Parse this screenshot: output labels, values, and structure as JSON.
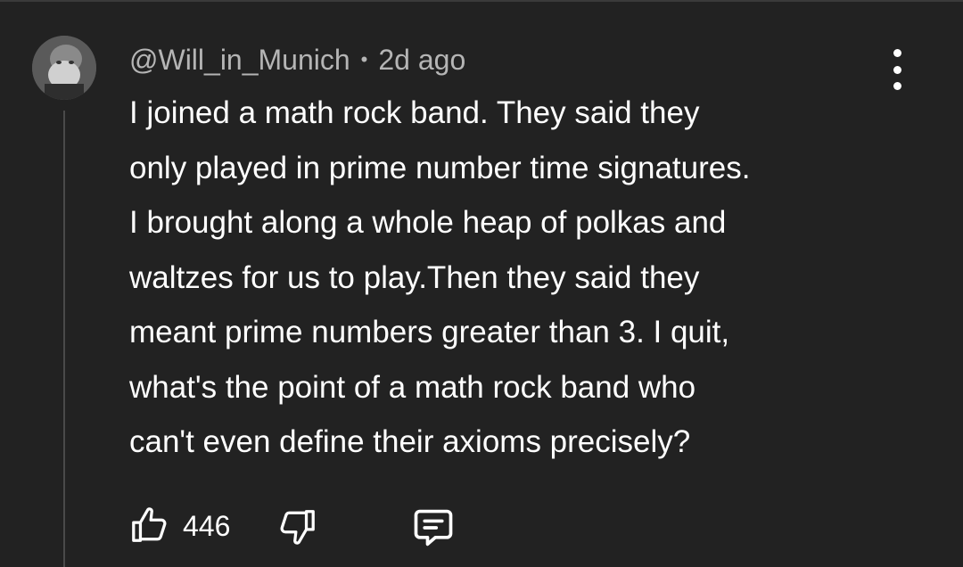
{
  "comment": {
    "author": "@Will_in_Munich",
    "separator": "•",
    "time": "2d ago",
    "text": "I joined a math rock band. They said they\nonly played in prime number time signatures.\nI brought along a whole heap of polkas and\nwaltzes for us to play.Then they said they\nmeant prime numbers greater than 3. I quit,\nwhat's the point of a math rock band who\ncan't even define their axioms precisely?",
    "likes": "446"
  },
  "icons": {
    "menu": "more-vert-icon",
    "like": "thumb-up-icon",
    "dislike": "thumb-down-icon",
    "reply": "comment-icon"
  },
  "colors": {
    "background": "#222222",
    "text": "#ffffff",
    "meta": "#b5b5b5",
    "thread_line": "#4a4a4a"
  }
}
